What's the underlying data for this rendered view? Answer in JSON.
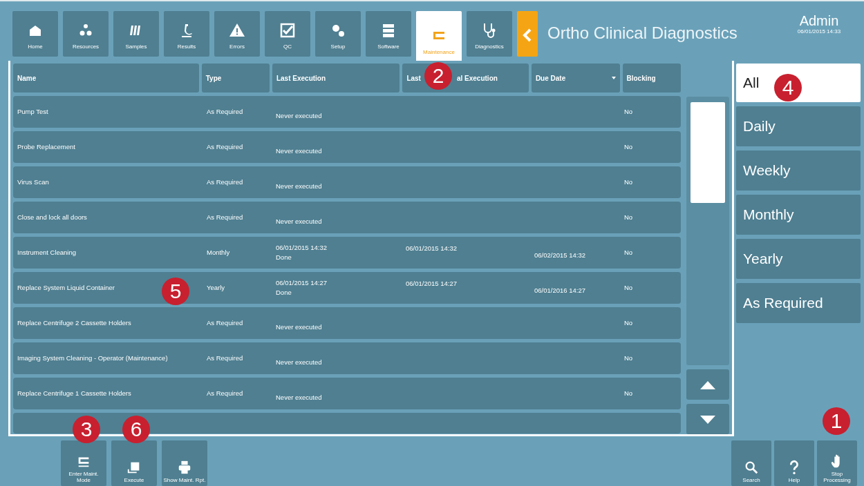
{
  "nav_tabs": [
    {
      "label": "Home",
      "selected": false
    },
    {
      "label": "Resources",
      "selected": false
    },
    {
      "label": "Samples",
      "selected": false
    },
    {
      "label": "Results",
      "selected": false
    },
    {
      "label": "Errors",
      "selected": false
    },
    {
      "label": "QC",
      "selected": false
    },
    {
      "label": "Setup",
      "selected": false
    },
    {
      "label": "Software",
      "selected": false
    },
    {
      "label": "Maintenance",
      "selected": true
    },
    {
      "label": "Diagnostics",
      "selected": false
    }
  ],
  "app_title": "Ortho Clinical Diagnostics",
  "user": {
    "name": "Admin",
    "datetime": "06/01/2015 14:33"
  },
  "table": {
    "columns": [
      {
        "label": "Name"
      },
      {
        "label": "Type"
      },
      {
        "label": "Last Execution"
      },
      {
        "label": "Last",
        "label_after": "al Execution"
      },
      {
        "label": "Due Date",
        "sorted": true
      },
      {
        "label": "Blocking"
      }
    ],
    "rows": [
      {
        "name": "Pump Test",
        "type": "As Required",
        "last_execution": "Never executed",
        "blocking": "No"
      },
      {
        "name": "Probe Replacement",
        "type": "As Required",
        "last_execution": "Never executed",
        "blocking": "No"
      },
      {
        "name": "Virus Scan",
        "type": "As Required",
        "last_execution": "Never executed",
        "blocking": "No"
      },
      {
        "name": "Close and lock all doors",
        "type": "As Required",
        "last_execution": "Never executed",
        "blocking": "No"
      },
      {
        "name": "Instrument Cleaning",
        "type": "Monthly",
        "last_execution": "06/01/2015 14:32",
        "status": "Done",
        "last_critical_execution": "06/01/2015 14:32",
        "due_date": "06/02/2015 14:32",
        "blocking": "No"
      },
      {
        "name": "Replace System Liquid Container",
        "type": "Yearly",
        "last_execution": "06/01/2015 14:27",
        "status": "Done",
        "last_critical_execution": "06/01/2015 14:27",
        "due_date": "06/01/2016 14:27",
        "blocking": "No"
      },
      {
        "name": "Replace Centrifuge 2 Cassette Holders",
        "type": "As Required",
        "last_execution": "Never executed",
        "blocking": "No"
      },
      {
        "name": "Imaging System Cleaning - Operator (Maintenance)",
        "type": "As Required",
        "last_execution": "Never executed",
        "blocking": "No"
      },
      {
        "name": "Replace Centrifuge 1 Cassette Holders",
        "type": "As Required",
        "last_execution": "Never executed",
        "blocking": "No"
      }
    ]
  },
  "filters": [
    {
      "label": "All",
      "selected": true
    },
    {
      "label": "Daily",
      "selected": false
    },
    {
      "label": "Weekly",
      "selected": false
    },
    {
      "label": "Monthly",
      "selected": false
    },
    {
      "label": "Yearly",
      "selected": false
    },
    {
      "label": "As Required",
      "selected": false
    }
  ],
  "bottom_left_buttons": [
    {
      "label": "Enter Maint. Mode",
      "disabled": false
    },
    {
      "label": "Execute",
      "disabled": false
    },
    {
      "label": "Show Maint. Rpt.",
      "disabled": false
    }
  ],
  "bottom_right_buttons": [
    {
      "label": "Search"
    },
    {
      "label": "Help"
    },
    {
      "label": "Stop Processing"
    }
  ],
  "callouts": [
    "1",
    "2",
    "3",
    "4",
    "5",
    "6"
  ]
}
